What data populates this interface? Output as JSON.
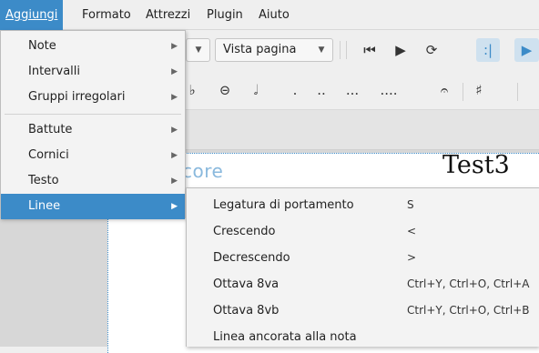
{
  "menubar": {
    "items": [
      {
        "label": "Aggiungi",
        "mnemonic": "A"
      },
      {
        "label": "Formato",
        "mnemonic": "F"
      },
      {
        "label": "Attrezzi",
        "mnemonic": "A"
      },
      {
        "label": "Plugin",
        "mnemonic": "P"
      },
      {
        "label": "Aiuto",
        "mnemonic": "A"
      }
    ]
  },
  "toolbar": {
    "view_mode": "Vista pagina",
    "zoom_value": ""
  },
  "note_palette": {
    "items": [
      "♭",
      "𝅝",
      "𝅗𝅥",
      ".",
      "..",
      "...",
      "....",
      "𝄐",
      "♯"
    ]
  },
  "menu": {
    "items": [
      {
        "label": "Note",
        "mn_index": 1
      },
      {
        "label": "Intervalli",
        "mn_index": 0
      },
      {
        "label": "Gruppi irregolari",
        "mn_index": 1
      },
      {
        "label": "Battute",
        "mn_index": 0
      },
      {
        "label": "Cornici",
        "mn_index": 0
      },
      {
        "label": "Testo",
        "mn_index": 0
      },
      {
        "label": "Linee",
        "mn_index": 0
      }
    ]
  },
  "submenu": {
    "items": [
      {
        "label": "Legatura di portamento",
        "shortcut": "S"
      },
      {
        "label": "Crescendo",
        "shortcut": "<"
      },
      {
        "label": "Decrescendo",
        "shortcut": ">"
      },
      {
        "label": "Ottava 8va",
        "shortcut": "Ctrl+Y, Ctrl+O, Ctrl+A"
      },
      {
        "label": "Ottava 8vb",
        "shortcut": "Ctrl+Y, Ctrl+O, Ctrl+B"
      },
      {
        "label": "Linea ancorata alla nota",
        "shortcut": ""
      }
    ]
  },
  "score": {
    "watermark": "core",
    "title": "Test3"
  },
  "colors": {
    "accent": "#3c8bc8",
    "menu_bg": "#f3f3f3"
  }
}
